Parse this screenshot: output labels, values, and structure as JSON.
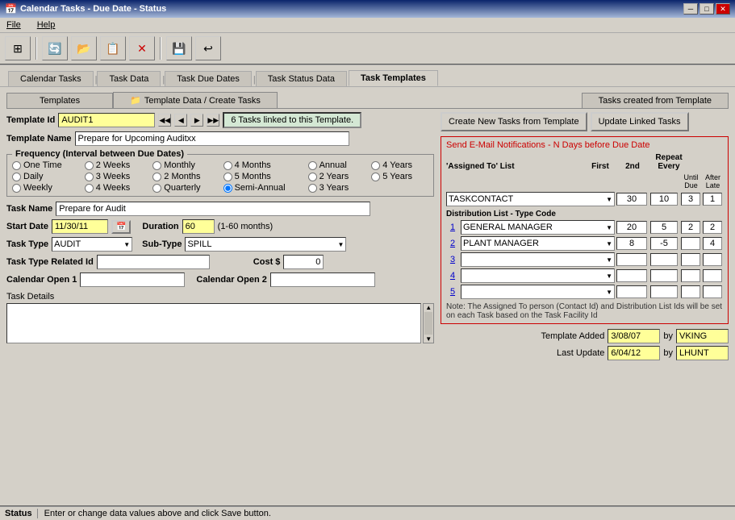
{
  "window": {
    "title": "Calendar Tasks - Due Date - Status",
    "icon": "calendar-icon"
  },
  "titlebar": {
    "min_btn": "─",
    "max_btn": "□",
    "close_btn": "✕"
  },
  "menu": {
    "items": [
      "File",
      "Help"
    ]
  },
  "toolbar": {
    "buttons": [
      "grid-icon",
      "refresh-icon",
      "open-icon",
      "copy-icon",
      "delete-icon",
      "save-icon",
      "undo-icon"
    ]
  },
  "outer_tabs": {
    "items": [
      "Calendar Tasks",
      "Task Data",
      "Task Due Dates",
      "Task Status Data",
      "Task Templates"
    ],
    "active": 4
  },
  "inner_tabs": {
    "left": "Templates",
    "middle_icon": "folder-icon",
    "middle": "Template Data / Create Tasks",
    "right": "Tasks created from Template"
  },
  "template_id": {
    "label": "Template Id",
    "value": "AUDIT1",
    "linked_msg": "6 Tasks linked to this Template."
  },
  "nav_buttons": [
    "◀◀",
    "◀",
    "▶",
    "▶▶"
  ],
  "template_name": {
    "label": "Template Name",
    "value": "Prepare for Upcoming Auditxx"
  },
  "frequency": {
    "legend": "Frequency (Interval between Due Dates)",
    "options": [
      {
        "label": "One Time",
        "name": "freq",
        "value": "onetime"
      },
      {
        "label": "2 Weeks",
        "name": "freq",
        "value": "2weeks"
      },
      {
        "label": "Monthly",
        "name": "freq",
        "value": "monthly"
      },
      {
        "label": "4 Months",
        "name": "freq",
        "value": "4months"
      },
      {
        "label": "Annual",
        "name": "freq",
        "value": "annual"
      },
      {
        "label": "4 Years",
        "name": "freq",
        "value": "4years"
      },
      {
        "label": "Daily",
        "name": "freq",
        "value": "daily"
      },
      {
        "label": "3 Weeks",
        "name": "freq",
        "value": "3weeks"
      },
      {
        "label": "2 Months",
        "name": "freq",
        "value": "2months"
      },
      {
        "label": "5 Months",
        "name": "freq",
        "value": "5months"
      },
      {
        "label": "2 Years",
        "name": "freq",
        "value": "2years"
      },
      {
        "label": "5 Years",
        "name": "freq",
        "value": "5years"
      },
      {
        "label": "Weekly",
        "name": "freq",
        "value": "weekly"
      },
      {
        "label": "4 Weeks",
        "name": "freq",
        "value": "4weeks"
      },
      {
        "label": "Quarterly",
        "name": "freq",
        "value": "quarterly"
      },
      {
        "label": "Semi-Annual",
        "name": "freq",
        "value": "semiannual"
      },
      {
        "label": "3 Years",
        "name": "freq",
        "value": "3years"
      }
    ],
    "selected": "semiannual"
  },
  "task_name": {
    "label": "Task Name",
    "value": "Prepare for Audit"
  },
  "start_date": {
    "label": "Start Date",
    "value": "11/30/11"
  },
  "duration": {
    "label": "Duration",
    "value": "60",
    "hint": "(1-60 months)"
  },
  "task_type": {
    "label": "Task Type",
    "value": "AUDIT"
  },
  "sub_type": {
    "label": "Sub-Type",
    "value": "SPILL"
  },
  "task_type_related": {
    "label": "Task Type Related Id",
    "value": ""
  },
  "cost": {
    "label": "Cost $",
    "value": "0"
  },
  "calendar_open1": {
    "label": "Calendar Open 1",
    "value": ""
  },
  "calendar_open2": {
    "label": "Calendar Open 2",
    "value": ""
  },
  "task_details": {
    "label": "Task Details",
    "value": ""
  },
  "right_panel": {
    "create_btn": "Create New Tasks from Template",
    "update_btn": "Update Linked Tasks",
    "notif_title": "Send E-Mail Notifications - N Days before Due Date",
    "assigned_to_label": "'Assigned To' List",
    "first_col": "First",
    "second_col": "2nd",
    "until_due": "Until Due",
    "after_late": "After Late",
    "repeat_every": "Repeat Every",
    "assigned_to_value": "TASKCONTACT",
    "first_val": "30",
    "second_val": "10",
    "until_val": "3",
    "after_val": "1",
    "dist_label": "Distribution List - Type Code",
    "dist_rows": [
      {
        "num": "1",
        "value": "GENERAL MANAGER",
        "first": "20",
        "second": "5",
        "until": "2",
        "after": "2"
      },
      {
        "num": "2",
        "value": "PLANT MANAGER",
        "first": "8",
        "second": "-5",
        "until": "",
        "after": "4"
      },
      {
        "num": "3",
        "value": "",
        "first": "",
        "second": "",
        "until": "",
        "after": ""
      },
      {
        "num": "4",
        "value": "",
        "first": "",
        "second": "",
        "until": "",
        "after": ""
      },
      {
        "num": "5",
        "value": "",
        "first": "",
        "second": "",
        "until": "",
        "after": ""
      }
    ],
    "note": "Note: The Assigned To person (Contact Id) and Distribution List Ids will be set on each Task based on the Task Facility Id",
    "template_added_label": "Template Added",
    "template_added_value": "3/08/07",
    "template_added_by": "VKING",
    "last_update_label": "Last Update",
    "last_update_value": "6/04/12",
    "last_update_by": "LHUNT"
  },
  "status": {
    "label": "Status",
    "text": "Enter or change data values above and click Save button."
  }
}
